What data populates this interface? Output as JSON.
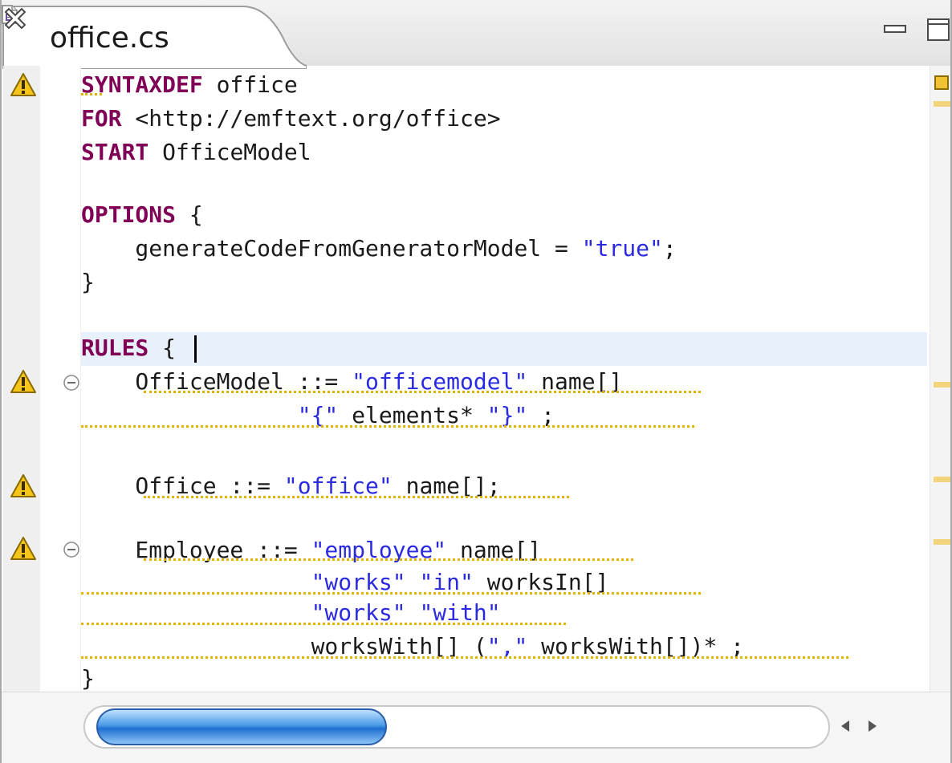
{
  "tab": {
    "title": "office.cs",
    "file_icon": "file-icon",
    "close_icon": "close-icon"
  },
  "window_controls": {
    "minimize_icon": "minimize-icon",
    "maximize_icon": "maximize-icon"
  },
  "colors": {
    "keyword": "#7f0055",
    "string": "#2a2ae0",
    "warning": "#e0b300",
    "current_line": "#e8f0fb",
    "scroll_thumb": "#4b9be8"
  },
  "gutter": {
    "warning_icon": "warning-icon",
    "fold_icon": "collapse-icon"
  },
  "code": {
    "line1": {
      "kw": "SYNTAXDEF",
      "rest": " office"
    },
    "line2": {
      "kw": "FOR",
      "rest": " <http://emftext.org/office>"
    },
    "line3": {
      "kw": "START",
      "rest": " OfficeModel"
    },
    "line5": {
      "kw": "OPTIONS",
      "rest": " {"
    },
    "line6": {
      "text": "    generateCodeFromGeneratorModel = ",
      "str": "\"true\"",
      "end": ";"
    },
    "line7": {
      "text": "}"
    },
    "line9": {
      "kw": "RULES",
      "rest": " {"
    },
    "line10": {
      "text": "    OfficeModel ::= ",
      "str": "\"officemodel\"",
      "end": " name[]"
    },
    "line11": {
      "indent": "                ",
      "str1": "\"{\"",
      "mid": " elements* ",
      "str2": "\"}\"",
      "end": " ;"
    },
    "line13": {
      "text": "    Office ::= ",
      "str": "\"office\"",
      "end": " name[];"
    },
    "line15": {
      "text": "    Employee ::= ",
      "str": "\"employee\"",
      "end": " name[]"
    },
    "line16": {
      "indent": "                 ",
      "str1": "\"works\"",
      "mid": " ",
      "str2": "\"in\"",
      "end": " worksIn[]"
    },
    "line17": {
      "indent": "                 ",
      "str1": "\"works\"",
      "mid": " ",
      "str2": "\"with\""
    },
    "line18": {
      "text": "                 worksWith[] (",
      "str": "\",\"",
      "end": " worksWith[])* ;"
    },
    "line19": {
      "text": "}"
    }
  },
  "scrollbar": {
    "left_arrow": "◀",
    "right_arrow": "▶"
  }
}
